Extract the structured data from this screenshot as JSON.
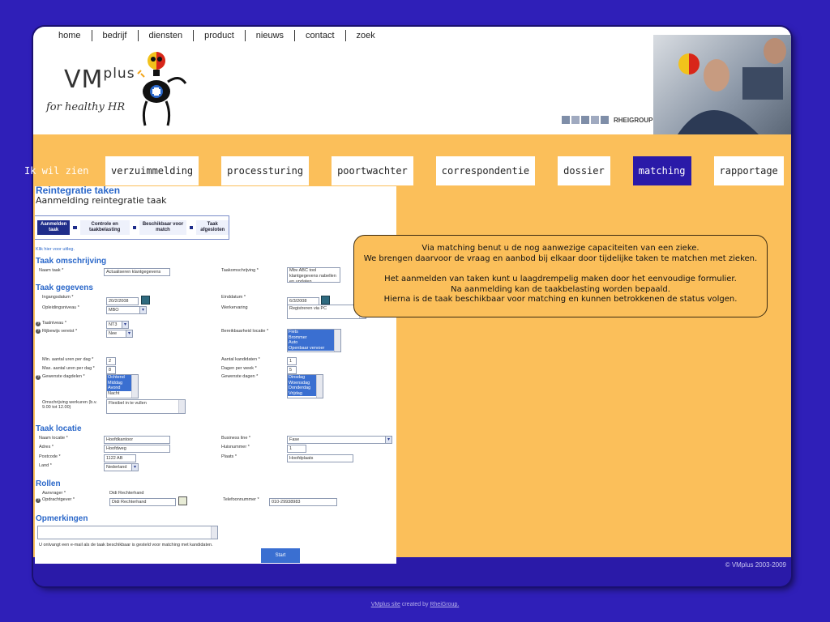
{
  "topnav": [
    "home",
    "bedrijf",
    "diensten",
    "product",
    "nieuws",
    "contact",
    "zoek"
  ],
  "logo": {
    "name": "VMplus",
    "tagline": "for healthy HR"
  },
  "partner": {
    "name": "RHEIGROUP"
  },
  "menu": {
    "prefix": "Ik wil zien",
    "tabs": [
      "verzuimmelding",
      "processturing",
      "poortwachter",
      "correspondentie",
      "dossier",
      "matching",
      "rapportage"
    ],
    "active": "matching"
  },
  "form": {
    "title": "Reintegratie taken",
    "subtitle": "Aanmelding reintegratie taak",
    "steps": [
      "Aanmelden taak",
      "Controle en taakbelasting",
      "Beschikbaar voor match",
      "Taak afgesloten"
    ],
    "help_link": "Klik hier voor uitleg.",
    "sections": {
      "omschrijving": "Taak omschrijving",
      "gegevens": "Taak gegevens",
      "locatie": "Taak locatie",
      "rollen": "Rollen",
      "opmerkingen": "Opmerkingen"
    },
    "fields": {
      "naam_taak_label": "Naam taak *",
      "naam_taak_value": "Actualiseren klantgegevens",
      "taakomschrijving_label": "Taakomschrijving *",
      "taakomschrijving_value": "Mbv ABC tool klantgegevens nabellen en updaten",
      "ingangsdatum_label": "Ingangsdatum *",
      "ingangsdatum_value": "20/2/2008",
      "einddatum_label": "Einddatum *",
      "einddatum_value": "6/3/2008",
      "opleidingsniveau_label": "Opleidingsniveau *",
      "opleidingsniveau_value": "MBO",
      "werkervaring_label": "Werkervaring",
      "werkervaring_value": "Registreren via PC",
      "taalniveau_label": "Taalniveau *",
      "taalniveau_value": "NT3",
      "rijbewijs_label": "Rijbewijs vereist *",
      "rijbewijs_value": "Nee",
      "bereikbaarheid_label": "Bereikbaarheid locatie *",
      "bereikbaarheid_options": [
        "Fiets",
        "Brommer",
        "Auto",
        "Openbaar vervoer"
      ],
      "min_uren_label": "Min. aantal uren per dag *",
      "min_uren_value": "2",
      "max_uren_label": "Max. aantal uren per dag *",
      "max_uren_value": "8",
      "aantal_kandidaten_label": "Aantal kandidaten *",
      "aantal_kandidaten_value": "1",
      "dagen_per_week_label": "Dagen per week *",
      "dagen_per_week_value": "5",
      "dagdelen_label": "Gewenste dagdelen *",
      "dagdelen_options": [
        "Ochtend",
        "Middag",
        "Avond",
        "Nacht"
      ],
      "dagen_label": "Gewenste dagen *",
      "dagen_options": [
        "Dinsdag",
        "Woensdag",
        "Donderdag",
        "Vrijdag"
      ],
      "werktijden_label": "Omschrijving werkuren (b.v. 9.00 tot 12.00)",
      "werktijden_value": "Flexibel in te vullen",
      "naam_locatie_label": "Naam locatie *",
      "naam_locatie_value": "Hoofdkantoor",
      "business_line_label": "Business line *",
      "business_line_value": "Fase",
      "adres_label": "Adres *",
      "adres_value": "Hoofdweg",
      "huisnummer_label": "Huisnummer *",
      "huisnummer_value": "1",
      "postcode_label": "Postcode *",
      "postcode_value": "1122 AB",
      "plaats_label": "Plaats *",
      "plaats_value": "Hoofdplaats",
      "land_label": "Land *",
      "land_value": "Nederland",
      "aanvrager_label": "Aanvrager *",
      "aanvrager_value": "Didi Rechterhand",
      "opdrachtgever_label": "Opdrachtgever *",
      "opdrachtgever_value": "Didi Rechterhand",
      "telefoon_label": "Telefoonnummer *",
      "telefoon_value": "010-29938983"
    },
    "notice": "U ontvangt een e-mail als de taak beschikbaar is gesteld voor matching met kandidaten.",
    "start_label": "Start"
  },
  "tooltip": {
    "line1": "Via matching benut u de nog aanwezige capaciteiten van een zieke.",
    "line2": "We brengen daarvoor de vraag en aanbod bij elkaar door tijdelijke taken te matchen met zieken.",
    "line3": "Het aanmelden van taken kunt u laagdrempelig maken door het eenvoudige formulier.",
    "line4": "Na aanmelding kan de taakbelasting worden bepaald.",
    "line5": "Hierna is de taak beschikbaar voor matching en kunnen betrokkenen de status volgen."
  },
  "footer": {
    "copyright": "© VMplus 2003-2009",
    "credit_site": "VMplus site",
    "credit_text": "created by",
    "credit_link": "RheiGroup."
  },
  "colors": {
    "accent": "#2a1aa8",
    "orange": "#fbbf5a",
    "link": "#2a67c9"
  }
}
